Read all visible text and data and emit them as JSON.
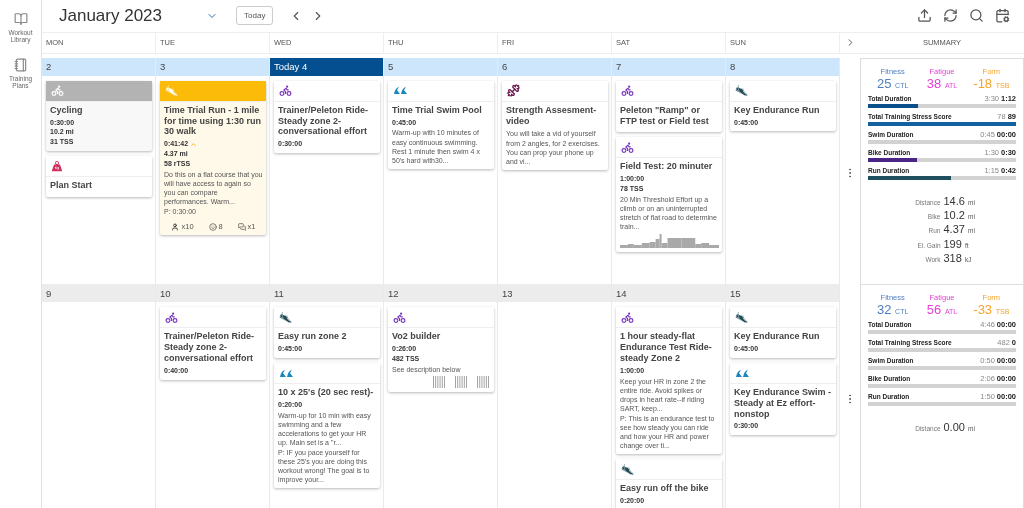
{
  "sidebar": [
    {
      "kind": "library",
      "label": "Workout Library"
    },
    {
      "kind": "plans",
      "label": "Training Plans"
    }
  ],
  "header": {
    "month": "January 2023",
    "today_button": "Today"
  },
  "weekdays": [
    "MON",
    "TUE",
    "WED",
    "THU",
    "FRI",
    "SAT",
    "SUN"
  ],
  "summary_title": "SUMMARY",
  "weeks": [
    {
      "current": true,
      "days": [
        {
          "date": "2",
          "today": false,
          "workouts": [
            {
              "kind": "bike",
              "completed": true,
              "color": "#b3b3b3",
              "title": "Cycling",
              "stats": [
                "0:30:00",
                "10.2 mi",
                "31 TSS"
              ]
            },
            {
              "kind": "event",
              "completed": false,
              "title": "Plan Start"
            }
          ]
        },
        {
          "date": "3",
          "today": false,
          "workouts": [
            {
              "kind": "run",
              "completed": true,
              "color": "#fbbb08",
              "title": "Time Trial Run - 1 mile for time using 1:30 run 30 walk",
              "stats": [
                "0:41:42",
                "4.37 mi",
                "58 rTSS"
              ],
              "over_planned": true,
              "description": "Do this on a flat course that you will have access to again so you can compare performances. Warm...",
              "plan_note": "P: 0:30:00",
              "counters": [
                {
                  "kind": "athlete",
                  "text": "x10"
                },
                {
                  "kind": "feeling",
                  "text": "8"
                },
                {
                  "kind": "comments",
                  "text": "x1"
                }
              ]
            }
          ]
        },
        {
          "date": "Today 4",
          "today": true,
          "workouts": [
            {
              "kind": "bike",
              "completed": false,
              "title": "Trainer/Peleton Ride-Steady zone 2-conversational effort",
              "stats": [
                "0:30:00"
              ]
            }
          ]
        },
        {
          "date": "5",
          "today": false,
          "workouts": [
            {
              "kind": "swim",
              "completed": false,
              "title": "Time Trial Swim Pool",
              "stats": [
                "0:45:00"
              ],
              "description": "Warm-up with 10 minutes of easy continuous swimming. Rest 1 minute then swim 4 x 50's hard with30..."
            }
          ]
        },
        {
          "date": "6",
          "today": false,
          "workouts": [
            {
              "kind": "strength",
              "completed": false,
              "title": "Strength Assesment-video",
              "description": "You will take a vid of yourself from 2 angles, for 2 exercises. You can prop your phone up and vi..."
            }
          ]
        },
        {
          "date": "7",
          "today": false,
          "workouts": [
            {
              "kind": "bike",
              "completed": false,
              "title": "Peleton \"Ramp\" or FTP test or Field test"
            },
            {
              "kind": "bike",
              "completed": false,
              "title": "Field Test: 20 minuter",
              "stats": [
                "1:00:00",
                "78 TSS"
              ],
              "description": "20 Min Threshold Effort up a climb or on an uninterrupted stretch of flat road to determine train...",
              "profile": {
                "kind": "power"
              }
            }
          ]
        },
        {
          "date": "8",
          "today": false,
          "workouts": [
            {
              "kind": "run",
              "completed": false,
              "title": "Key Endurance Run",
              "stats": [
                "0:45:00"
              ]
            }
          ]
        }
      ],
      "summary": {
        "form": [
          {
            "label": "Fitness",
            "value": "25",
            "unit": "CTL",
            "color": "#4f7fbf"
          },
          {
            "label": "Fatigue",
            "value": "38",
            "unit": "ATL",
            "color": "#e53fd6"
          },
          {
            "label": "Form",
            "value": "-18",
            "unit": "TSB",
            "color": "#f5a32a"
          }
        ],
        "metrics": [
          {
            "label": "Total Duration",
            "planned": "3:30",
            "actual": "1:12",
            "level": 0.34,
            "color": "#0b4f8a"
          },
          {
            "label": "Total Training Stress Score",
            "planned": "78",
            "actual": "89",
            "level": 1,
            "color": "#12609f"
          },
          {
            "label": "Swim Duration",
            "planned": "0:45",
            "actual": "00:00",
            "level": 0
          },
          {
            "label": "Bike Duration",
            "planned": "1:30",
            "actual": "0:30",
            "level": 0.33,
            "color": "#4a2585"
          },
          {
            "label": "Run Duration",
            "planned": "1:15",
            "actual": "0:42",
            "level": 0.56,
            "color": "#1d4f5e"
          }
        ],
        "totals": [
          {
            "label": "Distance",
            "value": "14.6",
            "unit": "mi"
          },
          {
            "label": "Bike",
            "value": "10.2",
            "unit": "mi"
          },
          {
            "label": "Run",
            "value": "4.37",
            "unit": "mi"
          },
          {
            "label": "El. Gain",
            "value": "199",
            "unit": "ft"
          },
          {
            "label": "Work",
            "value": "318",
            "unit": "kJ"
          }
        ]
      }
    },
    {
      "current": false,
      "days": [
        {
          "date": "9",
          "today": false
        },
        {
          "date": "10",
          "today": false,
          "workouts": [
            {
              "kind": "bike",
              "completed": false,
              "title": "Trainer/Peleton Ride-Steady zone 2-conversational effort",
              "stats": [
                "0:40:00"
              ]
            }
          ]
        },
        {
          "date": "11",
          "today": false,
          "workouts": [
            {
              "kind": "run",
              "completed": false,
              "title": "Easy run zone 2",
              "stats": [
                "0:45:00"
              ]
            },
            {
              "kind": "swim",
              "completed": false,
              "title": "10 x 25's (20 sec rest)-",
              "stats": [
                "0:20:00"
              ],
              "description": "Warm-up for 10 min with easy swimming and a few accelerations to get your HR up. Main set is a \"r...",
              "plan_note": "P: IF you pace yourself for these 25's you are doing this workout wrong! The goal is to improve your..."
            }
          ]
        },
        {
          "date": "12",
          "today": false,
          "workouts": [
            {
              "kind": "bike",
              "completed": false,
              "title": "Vo2 builder",
              "stats": [
                "0:26:00",
                "482 TSS"
              ],
              "description": "See description below",
              "profile": {
                "kind": "intervals"
              }
            }
          ]
        },
        {
          "date": "13",
          "today": false
        },
        {
          "date": "14",
          "today": false,
          "workouts": [
            {
              "kind": "bike",
              "completed": false,
              "title": "1 hour steady-flat Endurance Test Ride-steady Zone 2",
              "stats": [
                "1:00:00"
              ],
              "description": "Keep your HR in zone 2 the entire ride. Avoid spikes or drops in heart rate--if riding SART, keep...",
              "plan_note": "P: This is an endurance test to see how steady you can ride and how your HR and power change over ti..."
            },
            {
              "kind": "run",
              "completed": false,
              "title": "Easy run off the bike",
              "stats": [
                "0:20:00"
              ]
            }
          ]
        },
        {
          "date": "15",
          "today": false,
          "workouts": [
            {
              "kind": "run",
              "completed": false,
              "title": "Key Endurance Run",
              "stats": [
                "0:45:00"
              ]
            },
            {
              "kind": "swim",
              "completed": false,
              "title": "Key Endurance Swim - Steady at Ez effort-nonstop",
              "stats": [
                "0:30:00"
              ]
            }
          ]
        }
      ],
      "summary": {
        "form": [
          {
            "label": "Fitness",
            "value": "32",
            "unit": "CTL",
            "color": "#4f7fbf"
          },
          {
            "label": "Fatigue",
            "value": "56",
            "unit": "ATL",
            "color": "#e53fd6"
          },
          {
            "label": "Form",
            "value": "-33",
            "unit": "TSB",
            "color": "#f5a32a"
          }
        ],
        "metrics": [
          {
            "label": "Total Duration",
            "planned": "4:46",
            "actual": "00:00",
            "level": 0
          },
          {
            "label": "Total Training Stress Score",
            "planned": "482",
            "actual": "0",
            "level": 0
          },
          {
            "label": "Swim Duration",
            "planned": "0:50",
            "actual": "00:00",
            "level": 0
          },
          {
            "label": "Bike Duration",
            "planned": "2:06",
            "actual": "00:00",
            "level": 0
          },
          {
            "label": "Run Duration",
            "planned": "1:50",
            "actual": "00:00",
            "level": 0
          }
        ],
        "totals": [
          {
            "label": "Distance",
            "value": "0.00",
            "unit": "mi"
          }
        ]
      }
    }
  ]
}
